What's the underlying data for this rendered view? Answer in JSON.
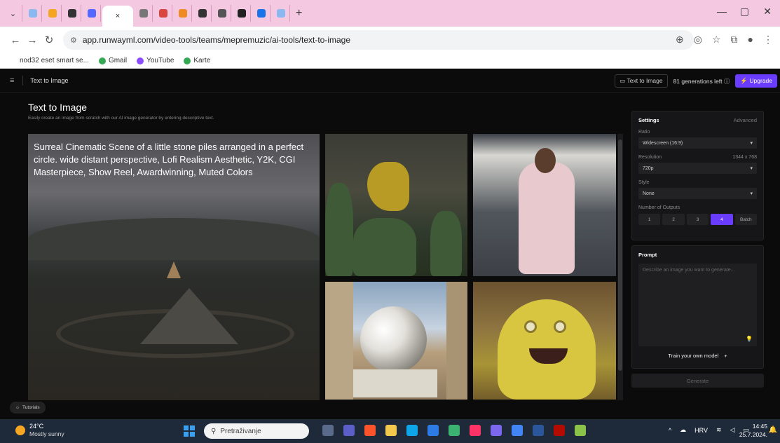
{
  "browser": {
    "tabs": [
      {
        "fav": "#8bb8f0"
      },
      {
        "fav": "#f4a623"
      },
      {
        "fav": "#333333"
      },
      {
        "fav": "#5468ff"
      },
      {
        "fav": "#777777"
      },
      {
        "fav": "#d9453f"
      },
      {
        "fav": "#f08a24"
      },
      {
        "fav": "#333333"
      },
      {
        "fav": "#555555"
      },
      {
        "fav": "#222222"
      },
      {
        "fav": "#1a73e8"
      },
      {
        "fav": "#8bb8f0"
      }
    ],
    "active_tab_close": "×",
    "new_tab": "+",
    "url": "app.runwayml.com/video-tools/teams/mepremuzic/ai-tools/text-to-image",
    "bookmarks": [
      {
        "label": "nod32 eset smart se...",
        "color": "#ffffff"
      },
      {
        "label": "Gmail",
        "color": "#34a853"
      },
      {
        "label": "YouTube",
        "color": "#8c4cff"
      },
      {
        "label": "Karte",
        "color": "#34a853"
      }
    ]
  },
  "app": {
    "header_title": "Text to Image",
    "header_tool_btn": "Text to Image",
    "generations_left": "81 generations left",
    "upgrade_label": "Upgrade",
    "page_title": "Text to Image",
    "page_subtitle": "Easily create an image from scratch with our AI image generator by entering descriptive text.",
    "main_prompt_overlay": "Surreal Cinematic Scene of a little stone piles arranged in a perfect circle. wide distant perspective, Lofi Realism Aesthetic, Y2K, CGI Masterpiece, Show Reel, Awardwinning, Muted Colors",
    "tutorials_label": "Tutorials"
  },
  "settings": {
    "title": "Settings",
    "advanced": "Advanced",
    "ratio_label": "Ratio",
    "ratio_value": "Widescreen (16:9)",
    "resolution_label": "Resolution",
    "resolution_dims": "1344 x 768",
    "resolution_value": "720p",
    "style_label": "Style",
    "style_value": "None",
    "outputs_label": "Number of Outputs",
    "outputs": [
      "1",
      "2",
      "3",
      "4",
      "Batch"
    ],
    "outputs_selected": "4"
  },
  "prompt": {
    "title": "Prompt",
    "placeholder": "Describe an image you want to generate...",
    "train_label": "Train your own model",
    "generate_label": "Generate"
  },
  "taskbar": {
    "temp": "24°C",
    "weather": "Mostly sunny",
    "search_placeholder": "Pretraživanje",
    "lang": "HRV",
    "time": "14:45",
    "date": "25.7.2024."
  }
}
